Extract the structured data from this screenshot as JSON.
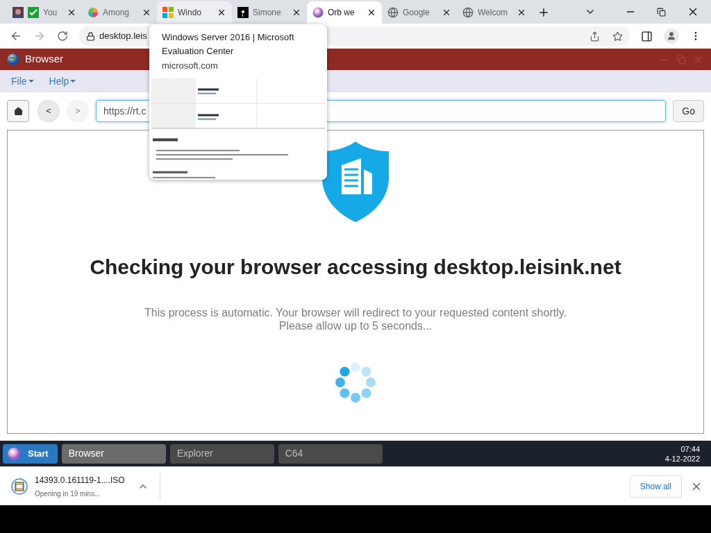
{
  "browser_tabs": [
    {
      "title": "You",
      "kind": "photo-check",
      "selected": false,
      "hovered": false
    },
    {
      "title": "Among",
      "kind": "pinwheel",
      "selected": false,
      "hovered": false
    },
    {
      "title": "Windo",
      "kind": "windows",
      "selected": false,
      "hovered": true
    },
    {
      "title": "Simone",
      "kind": "dark",
      "selected": false,
      "hovered": false
    },
    {
      "title": "Orb we",
      "kind": "orb",
      "selected": true,
      "hovered": false
    },
    {
      "title": "Google",
      "kind": "globe",
      "selected": false,
      "hovered": false
    },
    {
      "title": "Welcom",
      "kind": "globe",
      "selected": false,
      "hovered": false
    }
  ],
  "tab_preview": {
    "title": "Windows Server 2016 | Microsoft Evaluation Center",
    "domain": "microsoft.com"
  },
  "address_bar": {
    "url": "desktop.leis"
  },
  "app": {
    "title": "Browser",
    "menu": [
      "File",
      "Help"
    ],
    "back": "<",
    "forward": ">",
    "forward_disabled": true,
    "url": "https://rt.c",
    "go": "Go"
  },
  "page": {
    "heading": "Checking your browser accessing desktop.leisink.net",
    "lines": [
      "This process is automatic. Your browser will redirect to your requested content shortly.",
      "Please allow up to 5 seconds..."
    ]
  },
  "taskbar": {
    "start": "Start",
    "windows": [
      {
        "label": "Browser",
        "selected": true
      },
      {
        "label": "Explorer",
        "selected": false
      },
      {
        "label": "C64",
        "selected": false
      }
    ],
    "time": "07:44",
    "date": "4-12-2022"
  },
  "download": {
    "file": "14393.0.161119-1....ISO",
    "status": "Opening in 19 mins...",
    "show_all": "Show all"
  }
}
